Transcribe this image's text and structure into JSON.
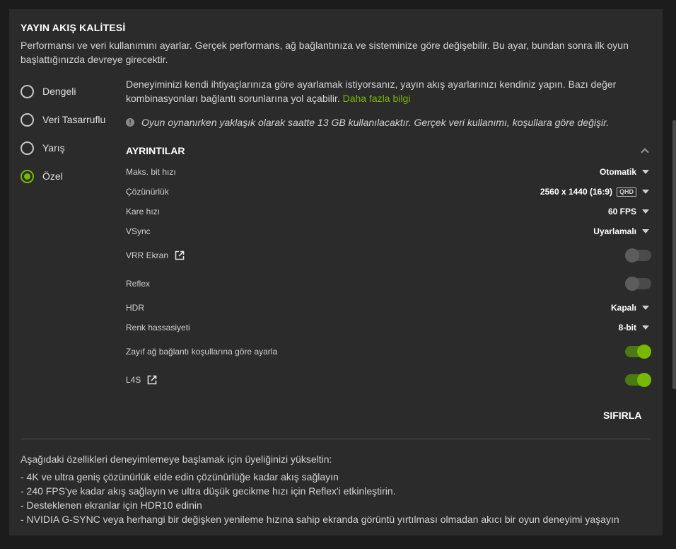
{
  "section": {
    "title": "YAYIN AKIŞ KALİTESİ",
    "description": "Performansı ve veri kullanımını ayarlar. Gerçek performans, ağ bağlantınıza ve sisteminize göre değişebilir. Bu ayar, bundan sonra ilk oyun başlattığınızda devreye girecektir."
  },
  "presets": [
    {
      "label": "Dengeli",
      "selected": false
    },
    {
      "label": "Veri Tasarruflu",
      "selected": false
    },
    {
      "label": "Yarış",
      "selected": false
    },
    {
      "label": "Özel",
      "selected": true
    }
  ],
  "custom": {
    "info": "Deneyiminizi kendi ihtiyaçlarınıza göre ayarlamak istiyorsanız, yayın akış ayarlarınızı kendiniz yapın. Bazı değer kombinasyonları bağlantı sorunlarına yol açabilir.",
    "learn_more": "Daha fazla bilgi",
    "notice": "Oyun oynanırken yaklaşık olarak saatte 13 GB kullanılacaktır. Gerçek veri kullanımı, koşullara göre değişir.",
    "notice_icon": "!"
  },
  "details": {
    "title": "AYRINTILAR",
    "rows": {
      "bitrate": {
        "label": "Maks. bit hızı",
        "value": "Otomatik"
      },
      "resolution": {
        "label": "Çözünürlük",
        "value": "2560 x 1440 (16:9)",
        "badge": "QHD"
      },
      "framerate": {
        "label": "Kare hızı",
        "value": "60 FPS"
      },
      "vsync": {
        "label": "VSync",
        "value": "Uyarlamalı"
      },
      "vrr": {
        "label": "VRR Ekran",
        "on": false
      },
      "reflex": {
        "label": "Reflex",
        "on": false
      },
      "hdr": {
        "label": "HDR",
        "value": "Kapalı"
      },
      "color": {
        "label": "Renk hassasiyeti",
        "value": "8-bit"
      },
      "adapt": {
        "label": "Zayıf ağ bağlantı koşullarına göre ayarla",
        "on": true
      },
      "l4s": {
        "label": "L4S",
        "on": true
      }
    }
  },
  "reset_label": "SIFIRLA",
  "upgrade": {
    "intro": "Aşağıdaki özellikleri deneyimlemeye başlamak için üyeliğinizi yükseltin:",
    "items": [
      "- 4K ve ultra geniş çözünürlük elde edin çözünürlüğe kadar akış sağlayın",
      "- 240 FPS'ye kadar akış sağlayın ve ultra düşük gecikme hızı için Reflex'i etkinleştirin.",
      "- Desteklenen ekranlar için HDR10 edinin",
      "- NVIDIA G-SYNC veya herhangi bir değişken yenileme hızına sahip ekranda görüntü yırtılması olmadan akıcı bir oyun deneyimi yaşayın"
    ]
  },
  "colors": {
    "accent": "#76b900",
    "panel": "#2b2b2b",
    "background": "#1c1c1c"
  }
}
